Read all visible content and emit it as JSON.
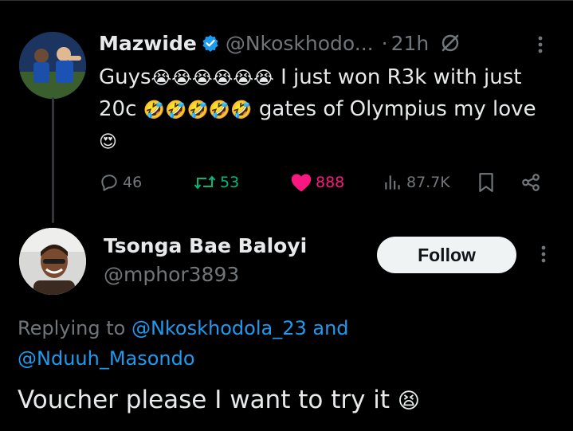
{
  "tweet": {
    "author_name": "Mazwide",
    "handle": "@Nkoskhodo...",
    "dot": "·",
    "time": "21h",
    "text_parts": {
      "p1": "Guys",
      "e1": "😭😭😭😭😭😭",
      "p2": " I just won R3k with just 20c ",
      "e2": "🤣🤣🤣🤣🤣",
      "p3": " gates of Olympius my love ",
      "e3": "😍"
    },
    "stats": {
      "replies": "46",
      "retweets": "53",
      "likes": "888",
      "views": "87.7K"
    }
  },
  "reply": {
    "author_name": "Tsonga Bae Baloyi",
    "handle": "@mphor3893",
    "follow_label": "Follow",
    "replying_prefix": "Replying to ",
    "mention1": "@Nkoskhodola_23",
    "and_word": " and",
    "mention2": "@Nduuh_Masondo",
    "text": "Voucher please I want to try it ",
    "emoji": "😫"
  },
  "colors": {
    "background": "#000000",
    "text": "#e7e9ea",
    "muted": "#71767b",
    "accent": "#1d9bf0",
    "retweet": "#00ba7c",
    "like": "#f91880"
  },
  "icons": [
    "verified-badge-icon",
    "grok-icon",
    "more-options-icon",
    "reply-icon",
    "retweet-icon",
    "like-icon",
    "views-icon",
    "bookmark-icon",
    "share-icon"
  ]
}
